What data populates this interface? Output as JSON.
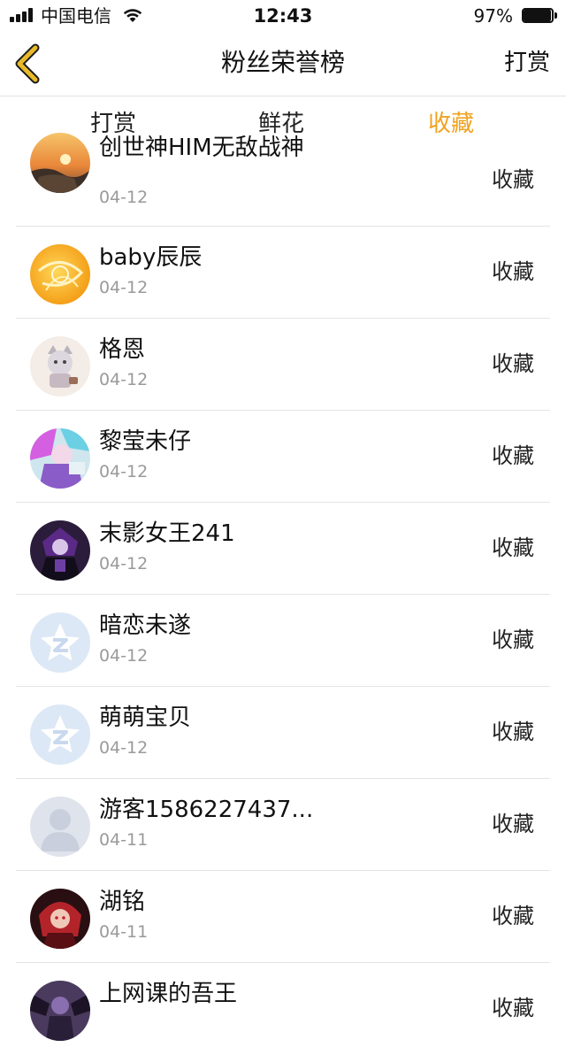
{
  "status_bar": {
    "carrier": "中国电信",
    "time": "12:43",
    "battery_percent": "97%",
    "battery_level": 0.97,
    "signal_bars": 4
  },
  "nav": {
    "title": "粉丝荣誉榜",
    "right_action": "打赏"
  },
  "tabs": [
    {
      "label": "打赏",
      "active": false
    },
    {
      "label": "鲜花",
      "active": false
    },
    {
      "label": "收藏",
      "active": true
    }
  ],
  "colors": {
    "accent": "#f0a21e",
    "back_icon": "#e8b92a",
    "date_text": "#9a9a9a",
    "divider": "#e4e4e4"
  },
  "list": [
    {
      "name": "创世神HIM无敌战神",
      "date": "04-12",
      "tag": "收藏",
      "avatar": "sunset-photo-avatar"
    },
    {
      "name": "baby辰辰",
      "date": "04-12",
      "tag": "收藏",
      "avatar": "orange-swirl-avatar"
    },
    {
      "name": "格恩",
      "date": "04-12",
      "tag": "收藏",
      "avatar": "anime-cat-avatar"
    },
    {
      "name": "黎莹未仔",
      "date": "04-12",
      "tag": "收藏",
      "avatar": "colorful-anime-avatar"
    },
    {
      "name": "末影女王241",
      "date": "04-12",
      "tag": "收藏",
      "avatar": "dark-anime-avatar"
    },
    {
      "name": "暗恋未遂",
      "date": "04-12",
      "tag": "收藏",
      "avatar": "qzone-star-avatar"
    },
    {
      "name": "萌萌宝贝",
      "date": "04-12",
      "tag": "收藏",
      "avatar": "qzone-star-avatar"
    },
    {
      "name": "游客1586227437...",
      "date": "04-11",
      "tag": "收藏",
      "avatar": "default-person-avatar"
    },
    {
      "name": "湖铭",
      "date": "04-11",
      "tag": "收藏",
      "avatar": "red-anime-avatar"
    },
    {
      "name": "上网课的吾王",
      "date": "",
      "tag": "收藏",
      "avatar": "dark-wings-avatar"
    }
  ]
}
